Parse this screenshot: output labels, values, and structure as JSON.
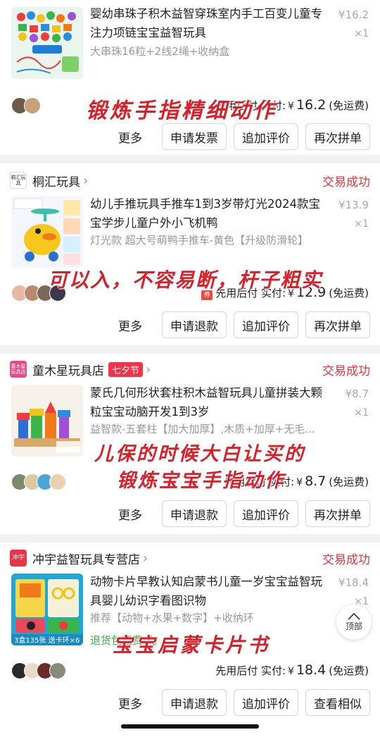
{
  "orders": [
    {
      "product_title": "婴幼串珠子积木益智穿珠室内手工百变儿童专注力项链宝宝益智玩具",
      "spec": "大串珠16粒+2线2绳+收纳盒",
      "price": "¥16.2",
      "qty": "×1",
      "pay_prefix": "先用后付 实付:",
      "pay_yen": "¥",
      "pay_amount": "16.2",
      "shipping": "(免运费)",
      "actions": [
        "更多",
        "申请发票",
        "追加评价",
        "再次拼单"
      ],
      "overlay": "锻炼手指精细动作"
    },
    {
      "shop_name": "桐汇玩具",
      "shop_logo": "桐汇玩具",
      "status": "交易成功",
      "product_title": "幼儿手推玩具手推车1到3岁带灯光2024款宝宝学步儿童户外小飞机鸭",
      "spec": "灯光款 超大号萌鸭手推车-黄色【升级防滑轮】",
      "price": "¥13.9",
      "qty": "×1",
      "pay_badge": "券",
      "pay_prefix": "先用后付 实付:",
      "pay_yen": "¥",
      "pay_amount": "12.9",
      "shipping": "(免运费)",
      "actions": [
        "更多",
        "申请退款",
        "追加评价",
        "再次拼单"
      ],
      "overlay": "可以入，不容易断，杆子粗实"
    },
    {
      "shop_name": "童木星玩具店",
      "shop_logo": "童木星玩具店",
      "shop_tag": "七夕节",
      "status": "交易成功",
      "product_title": "蒙氏几何形状套柱积木益智玩具儿童拼装大颗粒宝宝动脑开发1到3岁",
      "spec": "益智款-五套柱【加大加厚】,木质+加厚+无毛...",
      "price": "¥8.7",
      "qty": "×1",
      "pay_prefix": "先用后付 实付:",
      "pay_yen": "¥",
      "pay_amount": "8.7",
      "shipping": "(免运费)",
      "actions": [
        "更多",
        "申请退款",
        "追加评价",
        "再次拼单"
      ],
      "overlay_line1": "儿保的时候大白让买的",
      "overlay_line2": "锻炼宝宝手指动作"
    },
    {
      "shop_name": "冲宇益智玩具专营店",
      "shop_logo": "冲宇",
      "status": "交易成功",
      "product_title": "动物卡片早教认知启蒙书儿童一岁宝宝益智玩具婴儿幼识字看图识物",
      "spec": "推荐【动物+水果+数字】+收纳环",
      "price": "¥18.4",
      "qty": "×1",
      "green_note": "退货包运费·先",
      "thumb_caption": "3盒135张 送卡环×6",
      "pay_prefix": "先用后付 实付:",
      "pay_yen": "¥",
      "pay_amount": "18.4",
      "shipping": "(免运费)",
      "actions": [
        "更多",
        "申请退款",
        "追加评价",
        "查看相似"
      ],
      "overlay": "宝宝启蒙卡片书"
    }
  ],
  "top_button": {
    "label": "顶部"
  },
  "colors": {
    "status_red": "#e0353b",
    "overlay_red": "#d8202a",
    "tag_red": "#f2334a",
    "green": "#3cae4d"
  },
  "icons": [
    "chevron-right-icon",
    "arrow-up-icon",
    "shop-logo",
    "avatar"
  ]
}
